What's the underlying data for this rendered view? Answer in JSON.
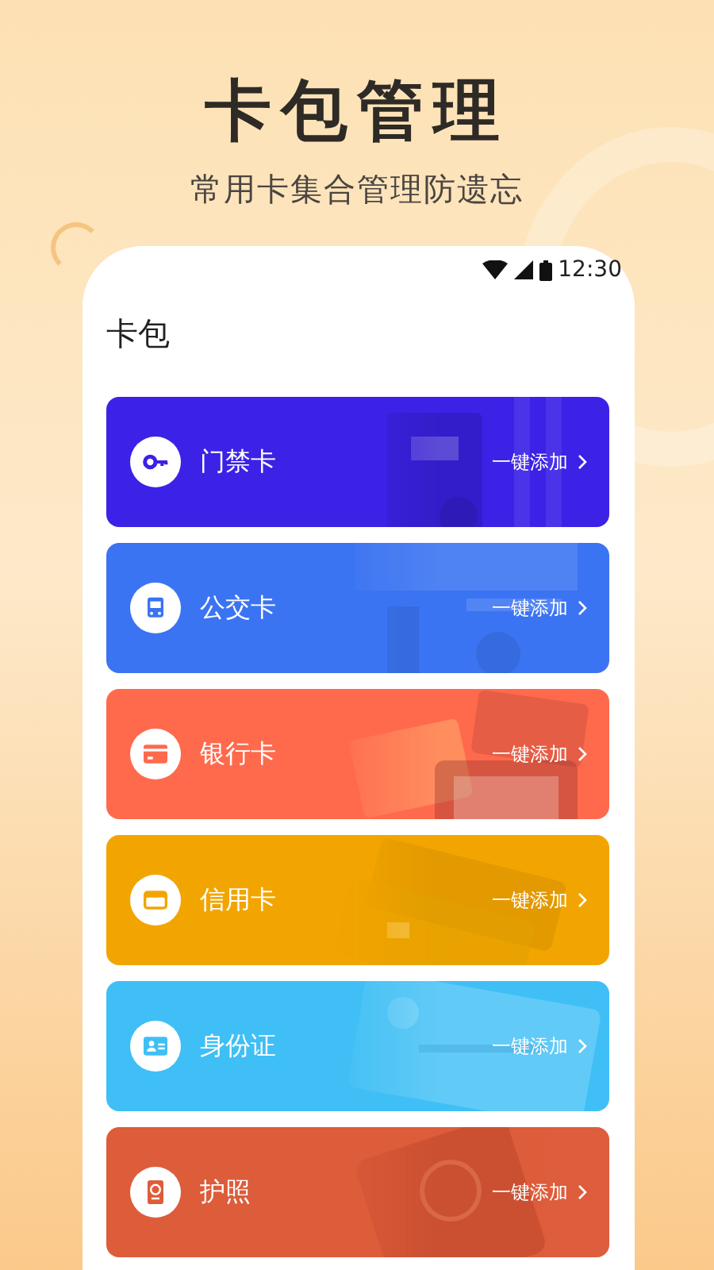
{
  "header": {
    "title": "卡包管理",
    "subtitle": "常用卡集合管理防遗忘"
  },
  "status_bar": {
    "time": "12:30"
  },
  "page": {
    "title": "卡包"
  },
  "cards": [
    {
      "name": "门禁卡",
      "action": "一键添加",
      "color": "#3b22e6"
    },
    {
      "name": "公交卡",
      "action": "一键添加",
      "color": "#3b74f2"
    },
    {
      "name": "银行卡",
      "action": "一键添加",
      "color": "#ff6a4d"
    },
    {
      "name": "信用卡",
      "action": "一键添加",
      "color": "#f2a500"
    },
    {
      "name": "身份证",
      "action": "一键添加",
      "color": "#3fbff5"
    },
    {
      "name": "护照",
      "action": "一键添加",
      "color": "#dd5c3a"
    }
  ]
}
